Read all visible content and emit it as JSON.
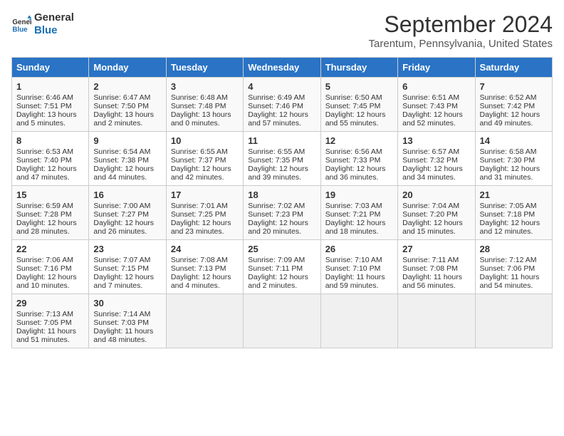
{
  "header": {
    "logo_line1": "General",
    "logo_line2": "Blue",
    "title": "September 2024",
    "subtitle": "Tarentum, Pennsylvania, United States"
  },
  "days_of_week": [
    "Sunday",
    "Monday",
    "Tuesday",
    "Wednesday",
    "Thursday",
    "Friday",
    "Saturday"
  ],
  "weeks": [
    [
      {
        "day": 1,
        "lines": [
          "Sunrise: 6:46 AM",
          "Sunset: 7:51 PM",
          "Daylight: 13 hours",
          "and 5 minutes."
        ]
      },
      {
        "day": 2,
        "lines": [
          "Sunrise: 6:47 AM",
          "Sunset: 7:50 PM",
          "Daylight: 13 hours",
          "and 2 minutes."
        ]
      },
      {
        "day": 3,
        "lines": [
          "Sunrise: 6:48 AM",
          "Sunset: 7:48 PM",
          "Daylight: 13 hours",
          "and 0 minutes."
        ]
      },
      {
        "day": 4,
        "lines": [
          "Sunrise: 6:49 AM",
          "Sunset: 7:46 PM",
          "Daylight: 12 hours",
          "and 57 minutes."
        ]
      },
      {
        "day": 5,
        "lines": [
          "Sunrise: 6:50 AM",
          "Sunset: 7:45 PM",
          "Daylight: 12 hours",
          "and 55 minutes."
        ]
      },
      {
        "day": 6,
        "lines": [
          "Sunrise: 6:51 AM",
          "Sunset: 7:43 PM",
          "Daylight: 12 hours",
          "and 52 minutes."
        ]
      },
      {
        "day": 7,
        "lines": [
          "Sunrise: 6:52 AM",
          "Sunset: 7:42 PM",
          "Daylight: 12 hours",
          "and 49 minutes."
        ]
      }
    ],
    [
      {
        "day": 8,
        "lines": [
          "Sunrise: 6:53 AM",
          "Sunset: 7:40 PM",
          "Daylight: 12 hours",
          "and 47 minutes."
        ]
      },
      {
        "day": 9,
        "lines": [
          "Sunrise: 6:54 AM",
          "Sunset: 7:38 PM",
          "Daylight: 12 hours",
          "and 44 minutes."
        ]
      },
      {
        "day": 10,
        "lines": [
          "Sunrise: 6:55 AM",
          "Sunset: 7:37 PM",
          "Daylight: 12 hours",
          "and 42 minutes."
        ]
      },
      {
        "day": 11,
        "lines": [
          "Sunrise: 6:55 AM",
          "Sunset: 7:35 PM",
          "Daylight: 12 hours",
          "and 39 minutes."
        ]
      },
      {
        "day": 12,
        "lines": [
          "Sunrise: 6:56 AM",
          "Sunset: 7:33 PM",
          "Daylight: 12 hours",
          "and 36 minutes."
        ]
      },
      {
        "day": 13,
        "lines": [
          "Sunrise: 6:57 AM",
          "Sunset: 7:32 PM",
          "Daylight: 12 hours",
          "and 34 minutes."
        ]
      },
      {
        "day": 14,
        "lines": [
          "Sunrise: 6:58 AM",
          "Sunset: 7:30 PM",
          "Daylight: 12 hours",
          "and 31 minutes."
        ]
      }
    ],
    [
      {
        "day": 15,
        "lines": [
          "Sunrise: 6:59 AM",
          "Sunset: 7:28 PM",
          "Daylight: 12 hours",
          "and 28 minutes."
        ]
      },
      {
        "day": 16,
        "lines": [
          "Sunrise: 7:00 AM",
          "Sunset: 7:27 PM",
          "Daylight: 12 hours",
          "and 26 minutes."
        ]
      },
      {
        "day": 17,
        "lines": [
          "Sunrise: 7:01 AM",
          "Sunset: 7:25 PM",
          "Daylight: 12 hours",
          "and 23 minutes."
        ]
      },
      {
        "day": 18,
        "lines": [
          "Sunrise: 7:02 AM",
          "Sunset: 7:23 PM",
          "Daylight: 12 hours",
          "and 20 minutes."
        ]
      },
      {
        "day": 19,
        "lines": [
          "Sunrise: 7:03 AM",
          "Sunset: 7:21 PM",
          "Daylight: 12 hours",
          "and 18 minutes."
        ]
      },
      {
        "day": 20,
        "lines": [
          "Sunrise: 7:04 AM",
          "Sunset: 7:20 PM",
          "Daylight: 12 hours",
          "and 15 minutes."
        ]
      },
      {
        "day": 21,
        "lines": [
          "Sunrise: 7:05 AM",
          "Sunset: 7:18 PM",
          "Daylight: 12 hours",
          "and 12 minutes."
        ]
      }
    ],
    [
      {
        "day": 22,
        "lines": [
          "Sunrise: 7:06 AM",
          "Sunset: 7:16 PM",
          "Daylight: 12 hours",
          "and 10 minutes."
        ]
      },
      {
        "day": 23,
        "lines": [
          "Sunrise: 7:07 AM",
          "Sunset: 7:15 PM",
          "Daylight: 12 hours",
          "and 7 minutes."
        ]
      },
      {
        "day": 24,
        "lines": [
          "Sunrise: 7:08 AM",
          "Sunset: 7:13 PM",
          "Daylight: 12 hours",
          "and 4 minutes."
        ]
      },
      {
        "day": 25,
        "lines": [
          "Sunrise: 7:09 AM",
          "Sunset: 7:11 PM",
          "Daylight: 12 hours",
          "and 2 minutes."
        ]
      },
      {
        "day": 26,
        "lines": [
          "Sunrise: 7:10 AM",
          "Sunset: 7:10 PM",
          "Daylight: 11 hours",
          "and 59 minutes."
        ]
      },
      {
        "day": 27,
        "lines": [
          "Sunrise: 7:11 AM",
          "Sunset: 7:08 PM",
          "Daylight: 11 hours",
          "and 56 minutes."
        ]
      },
      {
        "day": 28,
        "lines": [
          "Sunrise: 7:12 AM",
          "Sunset: 7:06 PM",
          "Daylight: 11 hours",
          "and 54 minutes."
        ]
      }
    ],
    [
      {
        "day": 29,
        "lines": [
          "Sunrise: 7:13 AM",
          "Sunset: 7:05 PM",
          "Daylight: 11 hours",
          "and 51 minutes."
        ]
      },
      {
        "day": 30,
        "lines": [
          "Sunrise: 7:14 AM",
          "Sunset: 7:03 PM",
          "Daylight: 11 hours",
          "and 48 minutes."
        ]
      },
      null,
      null,
      null,
      null,
      null
    ]
  ]
}
